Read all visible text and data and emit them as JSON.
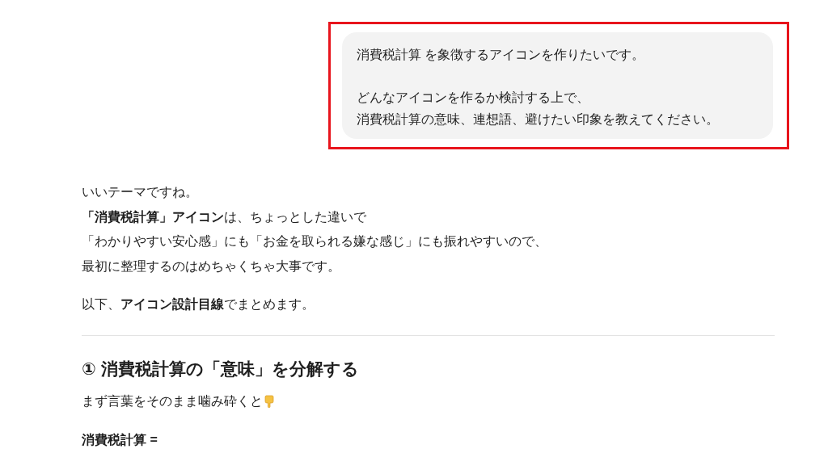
{
  "user_message": {
    "highlighted": true,
    "paragraphs": [
      [
        "消費税計算 を象徴するアイコンを作りたいです。"
      ],
      [
        "どんなアイコンを作るか検討する上で、",
        "消費税計算の意味、連想語、避けたい印象を教えてください。"
      ]
    ]
  },
  "reply": {
    "paragraphs": [
      [
        "いいテーマですね。",
        "**「消費税計算」アイコン**は、ちょっとした違いで",
        "「わかりやすい安心感」にも「お金を取られる嫌な感じ」にも振れやすいので、",
        "最初に整理するのはめちゃくちゃ大事です。"
      ],
      [
        "以下、**アイコン設計目線**でまとめます。"
      ]
    ],
    "heading": "① 消費税計算の「意味」を分解する",
    "intro": "まず言葉をそのまま噛み砕くと",
    "term": "消費税計算 ="
  }
}
